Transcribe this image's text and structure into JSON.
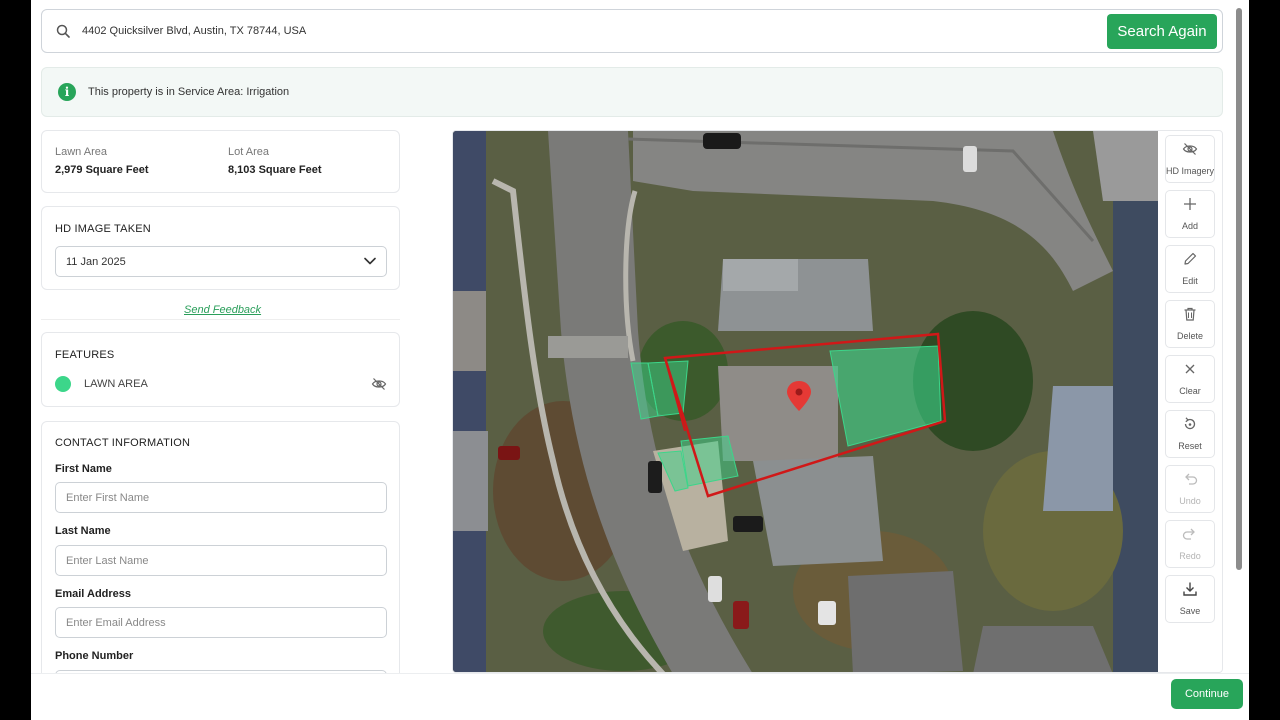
{
  "search": {
    "value": "4402 Quicksilver Blvd, Austin, TX 78744, USA",
    "button_label": "Search Again"
  },
  "notice": {
    "text": "This property is in Service Area: Irrigation",
    "icon": "info-icon"
  },
  "areas": {
    "lawn_label": "Lawn Area",
    "lawn_value": "2,979 Square Feet",
    "lot_label": "Lot Area",
    "lot_value": "8,103 Square Feet"
  },
  "hd_image": {
    "title": "HD IMAGE TAKEN",
    "selected_date": "11 Jan 2025"
  },
  "feedback_link": "Send Feedback",
  "features": {
    "title": "FEATURES",
    "items": [
      {
        "label": "LAWN AREA",
        "color": "#3cd68a"
      }
    ]
  },
  "contact": {
    "title": "CONTACT INFORMATION",
    "fields": [
      {
        "label": "First Name",
        "placeholder": "Enter First Name",
        "value": ""
      },
      {
        "label": "Last Name",
        "placeholder": "Enter Last Name",
        "value": ""
      },
      {
        "label": "Email Address",
        "placeholder": "Enter Email Address",
        "value": ""
      },
      {
        "label": "Phone Number",
        "placeholder": "",
        "value": ""
      }
    ]
  },
  "toolbar": [
    {
      "label": "HD Imagery",
      "icon": "eye-off-icon",
      "enabled": true
    },
    {
      "label": "Add",
      "icon": "plus-icon",
      "enabled": true
    },
    {
      "label": "Edit",
      "icon": "pencil-icon",
      "enabled": true
    },
    {
      "label": "Delete",
      "icon": "trash-icon",
      "enabled": true
    },
    {
      "label": "Clear",
      "icon": "close-icon",
      "enabled": true
    },
    {
      "label": "Reset",
      "icon": "reset-icon",
      "enabled": true
    },
    {
      "label": "Undo",
      "icon": "undo-icon",
      "enabled": false
    },
    {
      "label": "Redo",
      "icon": "redo-icon",
      "enabled": false
    },
    {
      "label": "Save",
      "icon": "download-icon",
      "enabled": true
    }
  ],
  "footer": {
    "continue_label": "Continue"
  },
  "colors": {
    "accent": "#28a55a",
    "lot_boundary": "#d01818",
    "lawn_polygon": "#3cd68a",
    "map_pin": "#e53935"
  }
}
